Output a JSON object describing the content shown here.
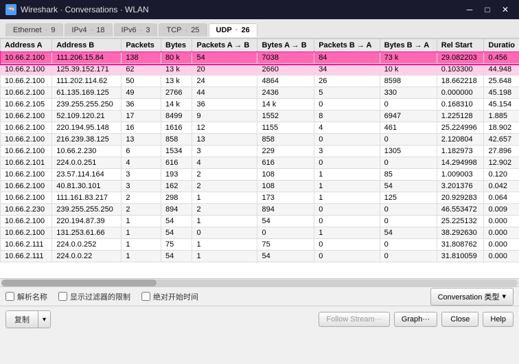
{
  "window": {
    "title": "Wireshark · Conversations · WLAN",
    "icon": "🦈"
  },
  "title_controls": {
    "minimize": "─",
    "maximize": "□",
    "close": "✕"
  },
  "tabs": [
    {
      "label": "Ethernet",
      "dot": "·",
      "count": "9",
      "active": false
    },
    {
      "label": "IPv4",
      "dot": "·",
      "count": "18",
      "active": false
    },
    {
      "label": "IPv6",
      "dot": "·",
      "count": "3",
      "active": false
    },
    {
      "label": "TCP",
      "dot": "·",
      "count": "25",
      "active": false
    },
    {
      "label": "UDP",
      "dot": "·",
      "count": "26",
      "active": true
    }
  ],
  "table": {
    "columns": [
      "Address A",
      "Address B",
      "Packets",
      "Bytes",
      "Packets A → B",
      "Bytes A → B",
      "Packets B → A",
      "Bytes B → A",
      "Rel Start",
      "Duratio"
    ],
    "rows": [
      {
        "highlight": true,
        "cells": [
          "10.66.2.100",
          "111.206.15.84",
          "138",
          "80 k",
          "54",
          "7038",
          "84",
          "73 k",
          "29.082203",
          "0.456"
        ]
      },
      {
        "highlight": "pink",
        "cells": [
          "10.66.2.100",
          "125.39.152.171",
          "62",
          "13 k",
          "20",
          "2660",
          "34",
          "10 k",
          "0.103300",
          "44.948"
        ]
      },
      {
        "cells": [
          "10.66.2.100",
          "111.202.114.62",
          "50",
          "13 k",
          "24",
          "4864",
          "26",
          "8598",
          "18.662218",
          "25.648"
        ]
      },
      {
        "cells": [
          "10.66.2.100",
          "61.135.169.125",
          "49",
          "2766",
          "44",
          "2436",
          "5",
          "330",
          "0.000000",
          "45.198"
        ]
      },
      {
        "cells": [
          "10.66.2.105",
          "239.255.255.250",
          "36",
          "14 k",
          "36",
          "14 k",
          "0",
          "0",
          "0.168310",
          "45.154"
        ]
      },
      {
        "cells": [
          "10.66.2.100",
          "52.109.120.21",
          "17",
          "8499",
          "9",
          "1552",
          "8",
          "6947",
          "1.225128",
          "1.885"
        ]
      },
      {
        "cells": [
          "10.66.2.100",
          "220.194.95.148",
          "16",
          "1616",
          "12",
          "1155",
          "4",
          "461",
          "25.224996",
          "18.902"
        ]
      },
      {
        "cells": [
          "10.66.2.100",
          "216.239.38.125",
          "13",
          "858",
          "13",
          "858",
          "0",
          "0",
          "2.120804",
          "42.657"
        ]
      },
      {
        "cells": [
          "10.66.2.100",
          "10.66.2.230",
          "6",
          "1534",
          "3",
          "229",
          "3",
          "1305",
          "1.182973",
          "27.896"
        ]
      },
      {
        "cells": [
          "10.66.2.101",
          "224.0.0.251",
          "4",
          "616",
          "4",
          "616",
          "0",
          "0",
          "14.294998",
          "12.902"
        ]
      },
      {
        "cells": [
          "10.66.2.100",
          "23.57.114.164",
          "3",
          "193",
          "2",
          "108",
          "1",
          "85",
          "1.009003",
          "0.120"
        ]
      },
      {
        "cells": [
          "10.66.2.100",
          "40.81.30.101",
          "3",
          "162",
          "2",
          "108",
          "1",
          "54",
          "3.201376",
          "0.042"
        ]
      },
      {
        "cells": [
          "10.66.2.100",
          "111.161.83.217",
          "2",
          "298",
          "1",
          "173",
          "1",
          "125",
          "20.929283",
          "0.064"
        ]
      },
      {
        "cells": [
          "10.66.2.230",
          "239.255.255.250",
          "2",
          "894",
          "2",
          "894",
          "0",
          "0",
          "46.553472",
          "0.009"
        ]
      },
      {
        "cells": [
          "10.66.2.100",
          "220.194.87.39",
          "1",
          "54",
          "1",
          "54",
          "0",
          "0",
          "25.225132",
          "0.000"
        ]
      },
      {
        "cells": [
          "10.66.2.100",
          "131.253.61.66",
          "1",
          "54",
          "0",
          "0",
          "1",
          "54",
          "38.292630",
          "0.000"
        ]
      },
      {
        "cells": [
          "10.66.2.111",
          "224.0.0.252",
          "1",
          "75",
          "1",
          "75",
          "0",
          "0",
          "31.808762",
          "0.000"
        ]
      },
      {
        "cells": [
          "10.66.2.111",
          "224.0.0.22",
          "1",
          "54",
          "1",
          "54",
          "0",
          "0",
          "31.810059",
          "0.000"
        ]
      }
    ]
  },
  "status_bar": {
    "checkbox1_label": "解析名称",
    "checkbox2_label": "显示过滤器的限制",
    "checkbox3_label": "绝对开始时间"
  },
  "buttons": {
    "copy": "复制",
    "dropdown_arrow": "▾",
    "follow_stream": "Follow Stream···",
    "graph": "Graph···",
    "close": "Close",
    "help": "Help",
    "conversation_type": "Conversation 类型"
  },
  "colors": {
    "highlight_row": "#ff69b4",
    "highlight_border": "#ff1493",
    "highlight_row2": "#ffd0e8",
    "header_bg": "#e8e8e8",
    "tab_active_bg": "white"
  }
}
